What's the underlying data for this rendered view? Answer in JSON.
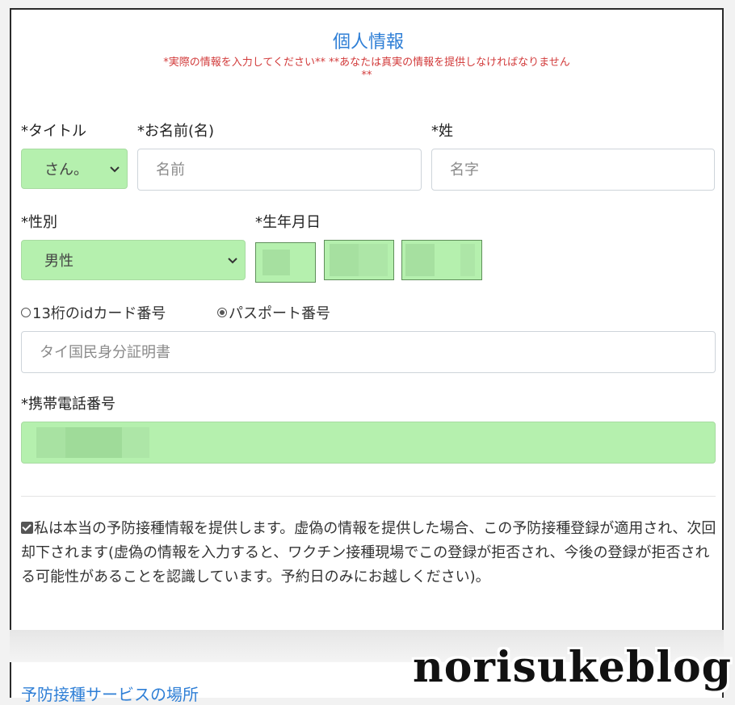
{
  "section": {
    "title": "個人情報",
    "warning_line1": "*実際の情報を入力してください**  **あなたは真実の情報を提供しなければなりません",
    "warning_line2": "**"
  },
  "form": {
    "title_label": "*タイトル",
    "title_value": "さん。",
    "first_name_label": "*お名前(名)",
    "first_name_placeholder": "名前",
    "last_name_label": "*姓",
    "last_name_placeholder": "名字",
    "gender_label": "*性別",
    "gender_value": "男性",
    "dob_label": "*生年月日",
    "id_type_options": [
      {
        "label": "13桁のidカード番号",
        "selected": false
      },
      {
        "label": "パスポート番号",
        "selected": true
      }
    ],
    "id_placeholder": "タイ国民身分証明書",
    "phone_label": "*携帯電話番号",
    "consent_text": "私は本当の予防接種情報を提供します。虚偽の情報を提供した場合、この予防接種登録が適用され、次回却下されます(虚偽の情報を入力すると、ワクチン接種現場でこの登録が拒否され、今後の登録が拒否される可能性があることを認識しています。予約日のみにお越しください)。",
    "consent_checked": true
  },
  "footer": {
    "next_section_link": "予防接種サービスの場所",
    "watermark": "norisukeblog"
  },
  "colors": {
    "accent": "#2f7fd6",
    "warning": "#d23b3b",
    "filled_field": "#b5f0ae"
  }
}
